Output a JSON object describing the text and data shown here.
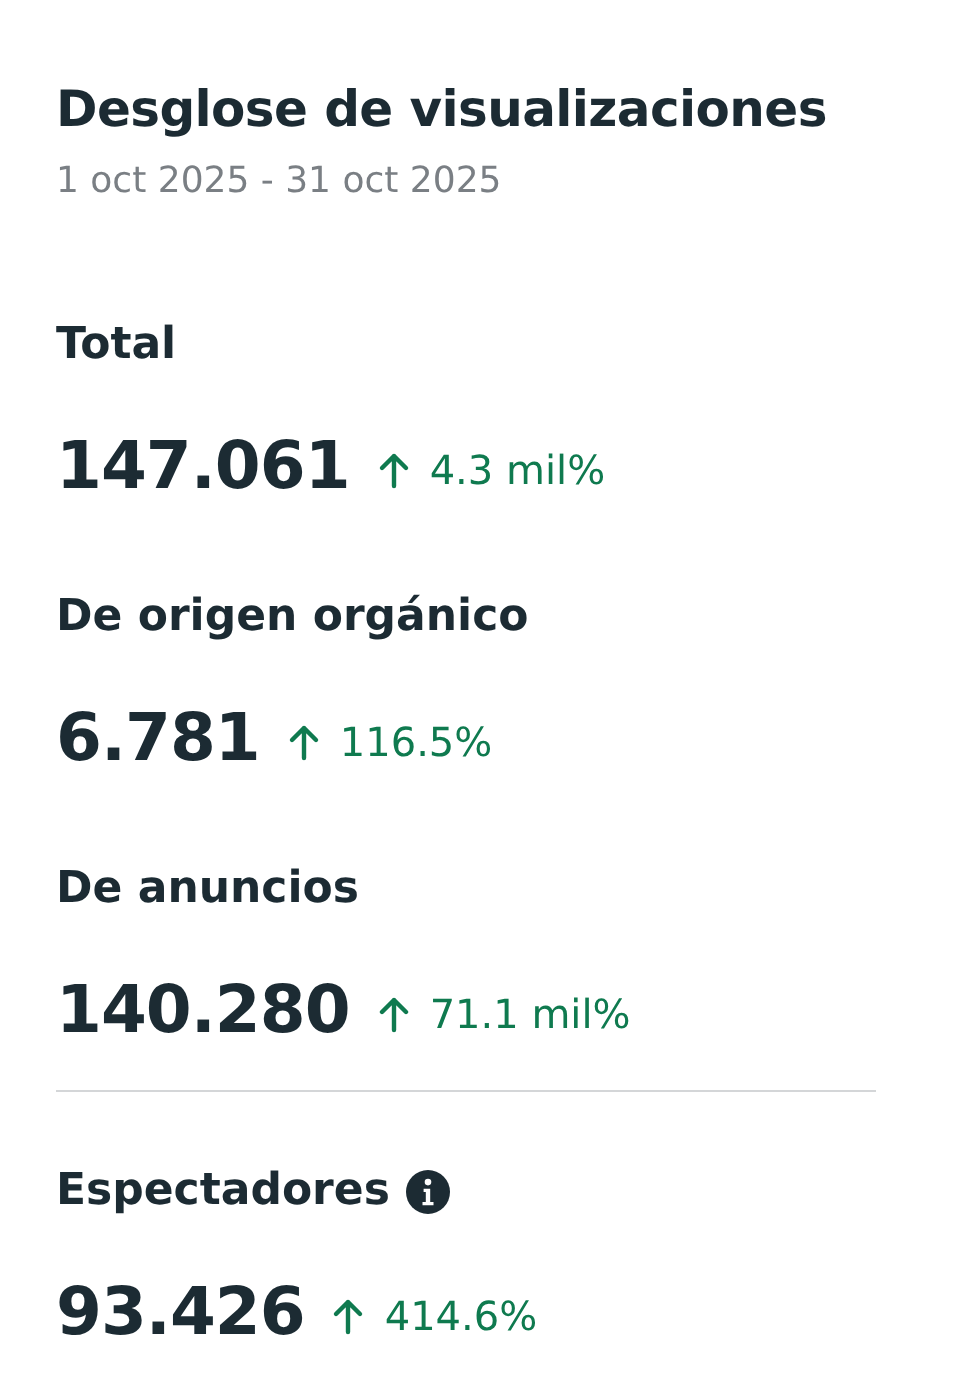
{
  "title": "Desglose de visualizaciones",
  "date_range": "1 oct 2025 - 31 oct 2025",
  "sections": [
    {
      "metrics": [
        {
          "label": "Total",
          "value": "147.061",
          "rising": true,
          "change": "4.3 mil%",
          "info": false
        },
        {
          "label": "De origen orgánico",
          "value": "6.781",
          "rising": true,
          "change": "116.5%",
          "info": false
        },
        {
          "label": "De anuncios",
          "value": "140.280",
          "rising": true,
          "change": "71.1 mil%",
          "info": false
        }
      ]
    },
    {
      "metrics": [
        {
          "label": "Espectadores",
          "value": "93.426",
          "rising": true,
          "change": "414.6%",
          "info": true
        }
      ]
    }
  ]
}
